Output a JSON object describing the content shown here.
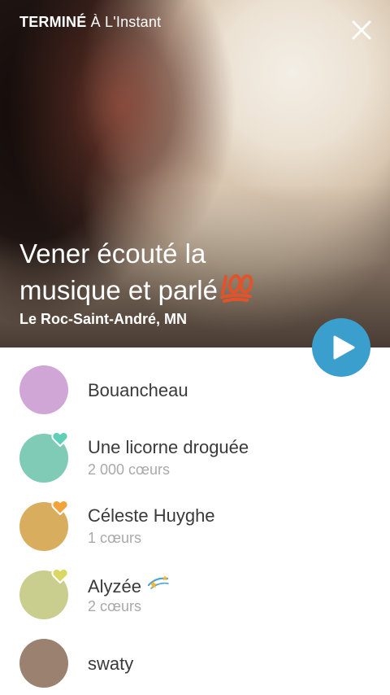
{
  "header": {
    "status_strong": "TERMINÉ",
    "status_rest": "À L'Instant",
    "title_line1": "Vener écouté la",
    "title_line2": "musique et parlé",
    "location": "Le Roc-Saint-André, MN",
    "close_icon": "close-icon",
    "emoji_icon": "hundred-points-icon"
  },
  "play_button": {
    "icon": "play-icon",
    "color": "#3b9fcd"
  },
  "viewers": [
    {
      "name": "Bouancheau",
      "hearts": "",
      "avatar_color": "#d0a6d6",
      "heart_color": ""
    },
    {
      "name": "Une licorne droguée",
      "hearts": "2 000 cœurs",
      "avatar_color": "#7fcbb5",
      "heart_color": "#5fd0b6"
    },
    {
      "name": "Céleste Huyghe",
      "hearts": "1 cœurs",
      "avatar_color": "#d8ad5e",
      "heart_color": "#f2a43a"
    },
    {
      "name": "Alyzée",
      "hearts": "2 cœurs",
      "avatar_color": "#c9cd8e",
      "heart_color": "#d8d862",
      "extra_icon": "sparkles-icon"
    },
    {
      "name": "swaty",
      "hearts": "",
      "avatar_color": "#9a8170",
      "heart_color": ""
    }
  ]
}
